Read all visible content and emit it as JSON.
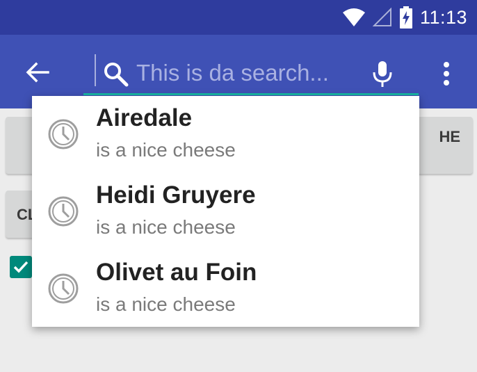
{
  "status_bar": {
    "time": "11:13",
    "icons": [
      "wifi-icon",
      "cell-signal-icon",
      "battery-charging-icon"
    ]
  },
  "app_bar": {
    "search": {
      "placeholder": "This is da search...",
      "value": ""
    },
    "icons": [
      "back-arrow-icon",
      "search-icon",
      "microphone-icon",
      "more-vert-icon"
    ]
  },
  "background": {
    "button_1_partial_label": "HE",
    "button_2_partial_label": "CL"
  },
  "suggestions": [
    {
      "title": "Airedale",
      "subtitle": "is a nice cheese",
      "icon": "history-icon"
    },
    {
      "title": "Heidi Gruyere",
      "subtitle": "is a nice cheese",
      "icon": "history-icon"
    },
    {
      "title": "Olivet au Foin",
      "subtitle": "is a nice cheese",
      "icon": "history-icon"
    }
  ],
  "colors": {
    "status_bar": "#2f3c9e",
    "app_bar": "#3f51b5",
    "accent": "#19b8a5",
    "checkbox": "#00897b"
  }
}
